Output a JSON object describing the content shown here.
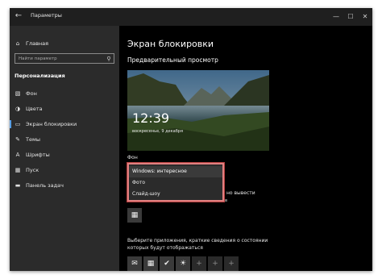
{
  "window": {
    "title": "Параметры",
    "back_glyph": "←",
    "minimize_glyph": "—",
    "maximize_glyph": "☐",
    "close_glyph": "✕"
  },
  "sidebar": {
    "home_label": "Главная",
    "home_icon": "⌂",
    "search_placeholder": "Найти параметр",
    "search_icon": "⚲",
    "section_title": "Персонализация",
    "items": [
      {
        "label": "Фон",
        "icon": "▧",
        "active": false
      },
      {
        "label": "Цвета",
        "icon": "◑",
        "active": false
      },
      {
        "label": "Экран блокировки",
        "icon": "▭",
        "active": true
      },
      {
        "label": "Темы",
        "icon": "✎",
        "active": false
      },
      {
        "label": "Шрифты",
        "icon": "A",
        "active": false
      },
      {
        "label": "Пуск",
        "icon": "▦",
        "active": false
      },
      {
        "label": "Панель задач",
        "icon": "▬",
        "active": false
      }
    ]
  },
  "main": {
    "page_title": "Экран блокировки",
    "preview_heading": "Предварительный просмотр",
    "preview": {
      "time": "12:39",
      "date": "воскресенье, 9 декабря"
    },
    "background_label": "Фон",
    "dropdown_options": [
      {
        "label": "Windows: интересное",
        "selected": true
      },
      {
        "label": "Фото",
        "selected": false
      },
      {
        "label": "Слайд-шоу",
        "selected": false
      }
    ],
    "covered_text_right": "но вывести",
    "calendar_icon": "▦",
    "apps_caption": "Выберите приложения, краткие сведения о состоянии которых будут отображаться",
    "quick_status_tiles": [
      {
        "icon": "✉",
        "name": "mail-tile",
        "dim": false
      },
      {
        "icon": "▦",
        "name": "calendar-tile",
        "dim": false
      },
      {
        "icon": "✔",
        "name": "check-tile",
        "dim": false
      },
      {
        "icon": "☀",
        "name": "weather-tile",
        "dim": false
      },
      {
        "icon": "+",
        "name": "add-tile-1",
        "dim": true
      },
      {
        "icon": "+",
        "name": "add-tile-2",
        "dim": true
      },
      {
        "icon": "+",
        "name": "add-tile-3",
        "dim": true
      }
    ]
  },
  "colors": {
    "window_bg": "#000000",
    "sidebar_bg": "#2b2b2b",
    "highlight_border": "#e08080",
    "accent": "#5aa0e6"
  }
}
